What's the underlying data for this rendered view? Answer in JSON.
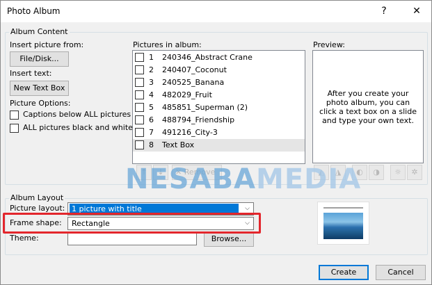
{
  "window": {
    "title": "Photo Album",
    "help_glyph": "?",
    "close_glyph": "✕"
  },
  "album_content": {
    "group_label": "Album Content",
    "insert_picture_label": "Insert picture from:",
    "file_disk_button": "File/Disk...",
    "insert_text_label": "Insert text:",
    "new_text_box_button": "New Text Box",
    "picture_options_label": "Picture Options:",
    "captions_option": "Captions below ALL pictures",
    "black_white_option": "ALL pictures black and white",
    "pictures_in_album_label": "Pictures in album:",
    "pictures": [
      {
        "num": "1",
        "name": "240346_Abstract Crane",
        "selected": false
      },
      {
        "num": "2",
        "name": "240407_Coconut",
        "selected": false
      },
      {
        "num": "3",
        "name": "240525_Banana",
        "selected": false
      },
      {
        "num": "4",
        "name": "482029_Fruit",
        "selected": false
      },
      {
        "num": "5",
        "name": "485851_Superman (2)",
        "selected": false
      },
      {
        "num": "6",
        "name": "488794_Friendship",
        "selected": false
      },
      {
        "num": "7",
        "name": "491216_City-3",
        "selected": false
      },
      {
        "num": "8",
        "name": "Text Box",
        "selected": true
      }
    ],
    "remove_button": "Remove",
    "preview_label": "Preview:",
    "preview_text": "After you create your photo album, you can click a text box on a slide and type your own text."
  },
  "watermark": {
    "part1": "NESABA",
    "part2": "MEDIA"
  },
  "album_layout": {
    "group_label": "Album Layout",
    "picture_layout_label": "Picture layout:",
    "picture_layout_value": "1 picture with title",
    "frame_shape_label": "Frame shape:",
    "frame_shape_value": "Rectangle",
    "theme_label": "Theme:",
    "theme_value": "",
    "browse_button": "Browse..."
  },
  "footer": {
    "create_button": "Create",
    "cancel_button": "Cancel"
  },
  "colors": {
    "accent": "#0078d7",
    "highlight_box": "#e3262c"
  }
}
